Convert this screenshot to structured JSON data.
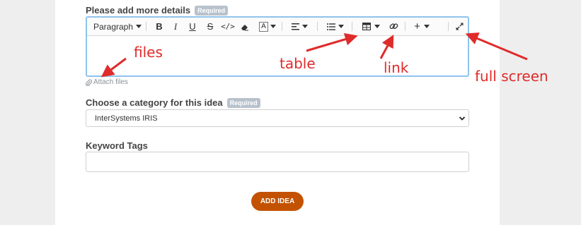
{
  "details": {
    "label": "Please add more details",
    "required_badge": "Required"
  },
  "toolbar": {
    "paragraph_label": "Paragraph",
    "items": [
      "bold-icon",
      "italic-icon",
      "underline-icon",
      "strikethrough-icon",
      "code-icon",
      "eraser-icon",
      "font-color-icon",
      "align-icon",
      "list-icon",
      "table-icon",
      "link-icon",
      "plus-icon",
      "fullscreen-icon"
    ],
    "font_color_letter": "A"
  },
  "attach": {
    "label": "Attach files",
    "icon": "paperclip-icon"
  },
  "category": {
    "label": "Choose a category for this idea",
    "required_badge": "Required",
    "selected": "InterSystems IRIS"
  },
  "keywords": {
    "label": "Keyword Tags",
    "value": ""
  },
  "submit": {
    "label": "ADD IDEA"
  },
  "annotations": {
    "files": "files",
    "table": "table",
    "link": "link",
    "full_screen": "full screen"
  },
  "colors": {
    "accent": "#c35200",
    "annotation": "#e02b2b",
    "focus_border": "#8fc3ee",
    "badge": "#b8c2cc"
  }
}
